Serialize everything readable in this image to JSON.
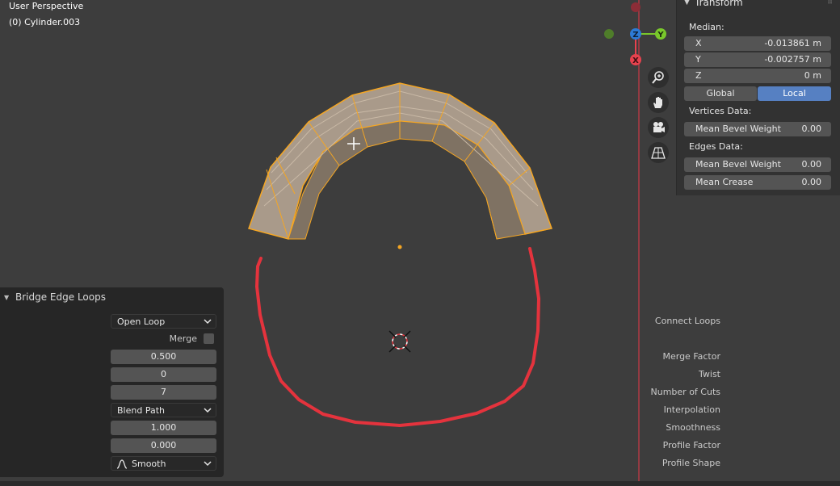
{
  "viewport": {
    "title": "User Perspective",
    "object_name": "(0) Cylinder.003"
  },
  "navigation_gizmo": {
    "axes": [
      {
        "name": "Z",
        "color": "#2d7bd6"
      },
      {
        "name": "Y",
        "color": "#79c82b"
      },
      {
        "name": "X",
        "color": "#e8424e"
      }
    ],
    "tools": [
      "zoom-icon",
      "hand-pan-icon",
      "camera-icon",
      "perspective-grid-icon"
    ]
  },
  "transform_panel": {
    "title": "Transform",
    "median_label": "Median:",
    "fields": [
      {
        "key": "X",
        "value": "-0.013861 m"
      },
      {
        "key": "Y",
        "value": "-0.002757 m"
      },
      {
        "key": "Z",
        "value": "0 m"
      }
    ],
    "global_label": "Global",
    "local_label": "Local",
    "active_space": "Local",
    "vertices_label": "Vertices Data:",
    "vertex_fields": [
      {
        "key": "Mean Bevel Weight",
        "value": "0.00"
      }
    ],
    "edges_label": "Edges Data:",
    "edge_fields": [
      {
        "key": "Mean Bevel Weight",
        "value": "0.00"
      },
      {
        "key": "Mean Crease",
        "value": "0.00"
      }
    ]
  },
  "operator_panel": {
    "title": "Bridge Edge Loops",
    "connect_loops": {
      "label": "Connect Loops",
      "value": "Open Loop"
    },
    "merge": {
      "label": "Merge",
      "checked": false
    },
    "merge_factor": {
      "label": "Merge Factor",
      "value": "0.500"
    },
    "twist": {
      "label": "Twist",
      "value": "0"
    },
    "number_of_cuts": {
      "label": "Number of Cuts",
      "value": "7"
    },
    "interpolation": {
      "label": "Interpolation",
      "value": "Blend Path"
    },
    "smoothness": {
      "label": "Smoothness",
      "value": "1.000"
    },
    "profile_factor": {
      "label": "Profile Factor",
      "value": "0.000"
    },
    "profile_shape": {
      "label": "Profile Shape",
      "value": "Smooth"
    }
  },
  "colors": {
    "mesh_face": "#a99a8a",
    "mesh_edge": "#f5a623",
    "annotation": "#e4333d",
    "active_button": "#5680c2"
  }
}
